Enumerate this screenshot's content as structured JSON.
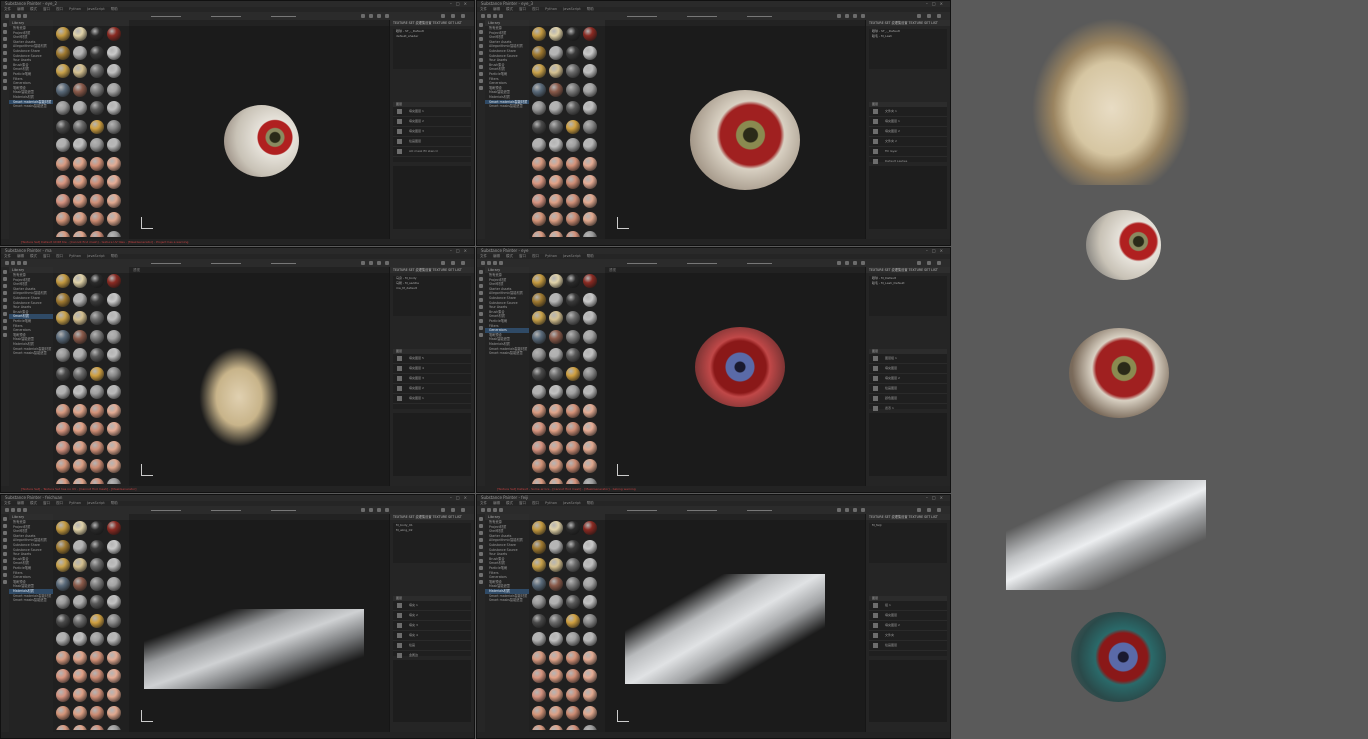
{
  "windows": [
    {
      "title": "Substance Painter - eye_2",
      "menus": [
        "文件",
        "编辑",
        "模式",
        "窗口",
        "视口",
        "Python",
        "JavaScript",
        "帮助"
      ],
      "viewport_label": "",
      "library_header": "Library",
      "library_items": [
        "所有资源",
        "Project材质",
        "Shelf材质",
        "Starter Assets",
        "Allegorithmic智能材质",
        "Substance Share",
        "Substance Source",
        "Your Assets",
        "Brush集合",
        "Smart材质",
        "Particle笔刷",
        "Filters",
        "Generators",
        "笔刷预设",
        "Mask智能遮罩",
        "Materials材质",
        "Smart materials智能材质",
        "Smart masks智能遮罩"
      ],
      "selected_item": 16,
      "tabs": "TEXTURE SET 纹理集设置   TEXTURE SET LIST",
      "texture_sets": [
        "眼球 - ST_-_Default",
        "default_shader",
        "",
        "",
        ""
      ],
      "layers_header": "图层",
      "layers": [
        "填充图层 1",
        "填充图层 2",
        "填充图层 3",
        "绘画图层",
        "AO mask fill stencil"
      ],
      "status": "[Texture Set] Default UDIM tile - [Cannot find mesh] - texture UV tiles - [MaskGenerator] - Project has a warning"
    },
    {
      "title": "Substance Painter - eye_3",
      "menus": [
        "文件",
        "编辑",
        "模式",
        "窗口",
        "视口",
        "Python",
        "JavaScript",
        "帮助"
      ],
      "viewport_label": "",
      "library_header": "Library",
      "library_items": [
        "所有资源",
        "Project材质",
        "Shelf材质",
        "Starter Assets",
        "Allegorithmic智能材质",
        "Substance Share",
        "Substance Source",
        "Your Assets",
        "Brush集合",
        "Smart材质",
        "Particle笔刷",
        "Filters",
        "Generators",
        "笔刷预设",
        "Mask智能遮罩",
        "Materials材质",
        "Smart materials智能材质",
        "Smart masks智能遮罩"
      ],
      "selected_item": 16,
      "tabs": "TEXTURE SET 纹理集设置   TEXTURE SET LIST",
      "texture_sets": [
        "眼球 - ST_-_Default",
        "睫毛 - M_Lash",
        "",
        "",
        ""
      ],
      "layers_header": "图层",
      "layers": [
        "文件夹 1",
        "填充图层 1",
        "填充图层 2",
        "文件夹 2",
        "Fill layer",
        "Default Lashes"
      ],
      "status": ""
    },
    {
      "title": "Substance Painter - ma",
      "menus": [
        "文件",
        "编辑",
        "模式",
        "窗口",
        "视口",
        "Python",
        "JavaScript",
        "帮助"
      ],
      "viewport_label": "透视",
      "library_header": "Library",
      "library_items": [
        "所有资源",
        "Project材质",
        "Shelf材质",
        "Starter Assets",
        "Allegorithmic智能材质",
        "Substance Share",
        "Substance Source",
        "Your Assets",
        "Brush集合",
        "Smart材质",
        "Particle笔刷",
        "Filters",
        "Generators",
        "笔刷预设",
        "Mask智能遮罩",
        "Materials材质",
        "Smart materials智能材质",
        "Smart masks智能遮罩"
      ],
      "selected_item": 9,
      "tabs": "TEXTURE SET 纹理集设置   TEXTURE SET LIST",
      "texture_sets": [
        "马身 - M_body",
        "马鞍 - M_saddle",
        "ma_M_default",
        "",
        ""
      ],
      "layers_header": "图层",
      "layers": [
        "填充图层 5",
        "填充图层 4",
        "填充图层 3",
        "填充图层 2",
        "填充图层 1"
      ],
      "status": "[Texture Set] - Texture Set has no UV - [Cannot find mesh] - [MaskGenerator]"
    },
    {
      "title": "Substance Painter - eye",
      "menus": [
        "文件",
        "编辑",
        "模式",
        "窗口",
        "视口",
        "Python",
        "JavaScript",
        "帮助"
      ],
      "viewport_label": "透视",
      "library_header": "Library",
      "library_items": [
        "所有资源",
        "Project材质",
        "Shelf材质",
        "Starter Assets",
        "Allegorithmic智能材质",
        "Substance Share",
        "Substance Source",
        "Your Assets",
        "Brush集合",
        "Smart材质",
        "Particle笔刷",
        "Filters",
        "Generators",
        "笔刷预设",
        "Mask智能遮罩",
        "Materials材质",
        "Smart materials智能材质",
        "Smart masks智能遮罩"
      ],
      "selected_item": 12,
      "tabs": "TEXTURE SET 纹理集设置   TEXTURE SET LIST",
      "texture_sets": [
        "眼球 - M_Default",
        "睫毛 - M_Lash_Default",
        "",
        "",
        ""
      ],
      "layers_header": "图层",
      "layers": [
        "图层组 1",
        "填充图层",
        "填充图层 2",
        "绘画图层",
        "颜色图层",
        "遮罩 1"
      ],
      "status": "[Texture Set] Default - Some errors - [Cannot find mesh] - [MaskGenerator] - baking warning"
    },
    {
      "title": "Substance Painter - feichuan",
      "menus": [
        "文件",
        "编辑",
        "模式",
        "窗口",
        "视口",
        "Python",
        "JavaScript",
        "帮助"
      ],
      "viewport_label": "",
      "library_header": "Library",
      "library_items": [
        "所有资源",
        "Project材质",
        "Shelf材质",
        "Starter Assets",
        "Allegorithmic智能材质",
        "Substance Share",
        "Substance Source",
        "Your Assets",
        "Brush集合",
        "Smart材质",
        "Particle笔刷",
        "Filters",
        "Generators",
        "笔刷预设",
        "Mask智能遮罩",
        "Materials材质",
        "Smart materials智能材质",
        "Smart masks智能遮罩"
      ],
      "selected_item": 15,
      "tabs": "TEXTURE SET 纹理集设置   TEXTURE SET LIST",
      "texture_sets": [
        "M_body_01",
        "M_wing_02",
        "",
        "",
        ""
      ],
      "layers_header": "图层",
      "layers": [
        "填充 1",
        "填充 2",
        "填充 3",
        "填充 4",
        "绘画",
        "金属边"
      ],
      "status": ""
    },
    {
      "title": "Substance Painter - feiji",
      "menus": [
        "文件",
        "编辑",
        "模式",
        "窗口",
        "视口",
        "Python",
        "JavaScript",
        "帮助"
      ],
      "viewport_label": "",
      "library_header": "Library",
      "library_items": [
        "所有资源",
        "Project材质",
        "Shelf材质",
        "Starter Assets",
        "Allegorithmic智能材质",
        "Substance Share",
        "Substance Source",
        "Your Assets",
        "Brush集合",
        "Smart材质",
        "Particle笔刷",
        "Filters",
        "Generators",
        "笔刷预设",
        "Mask智能遮罩",
        "Materials材质",
        "Smart materials智能材质",
        "Smart masks智能遮罩"
      ],
      "selected_item": 15,
      "tabs": "TEXTURE SET 纹理集设置   TEXTURE SET LIST",
      "texture_sets": [
        "M_feiji",
        "",
        "",
        "",
        ""
      ],
      "layers_header": "图层",
      "layers": [
        "组 1",
        "填充图层",
        "填充图层 2",
        "文件夹",
        "绘画图层"
      ],
      "status": ""
    }
  ],
  "colors": {
    "app_bg": "#1e1e1e",
    "panel_bg": "#5a5a5a",
    "selection": "#2f4a66",
    "status_error": "#c04040"
  },
  "showcase": [
    "horse-render",
    "eye-render-1",
    "eye-render-2",
    "spaceship-render",
    "eye-render-3"
  ]
}
